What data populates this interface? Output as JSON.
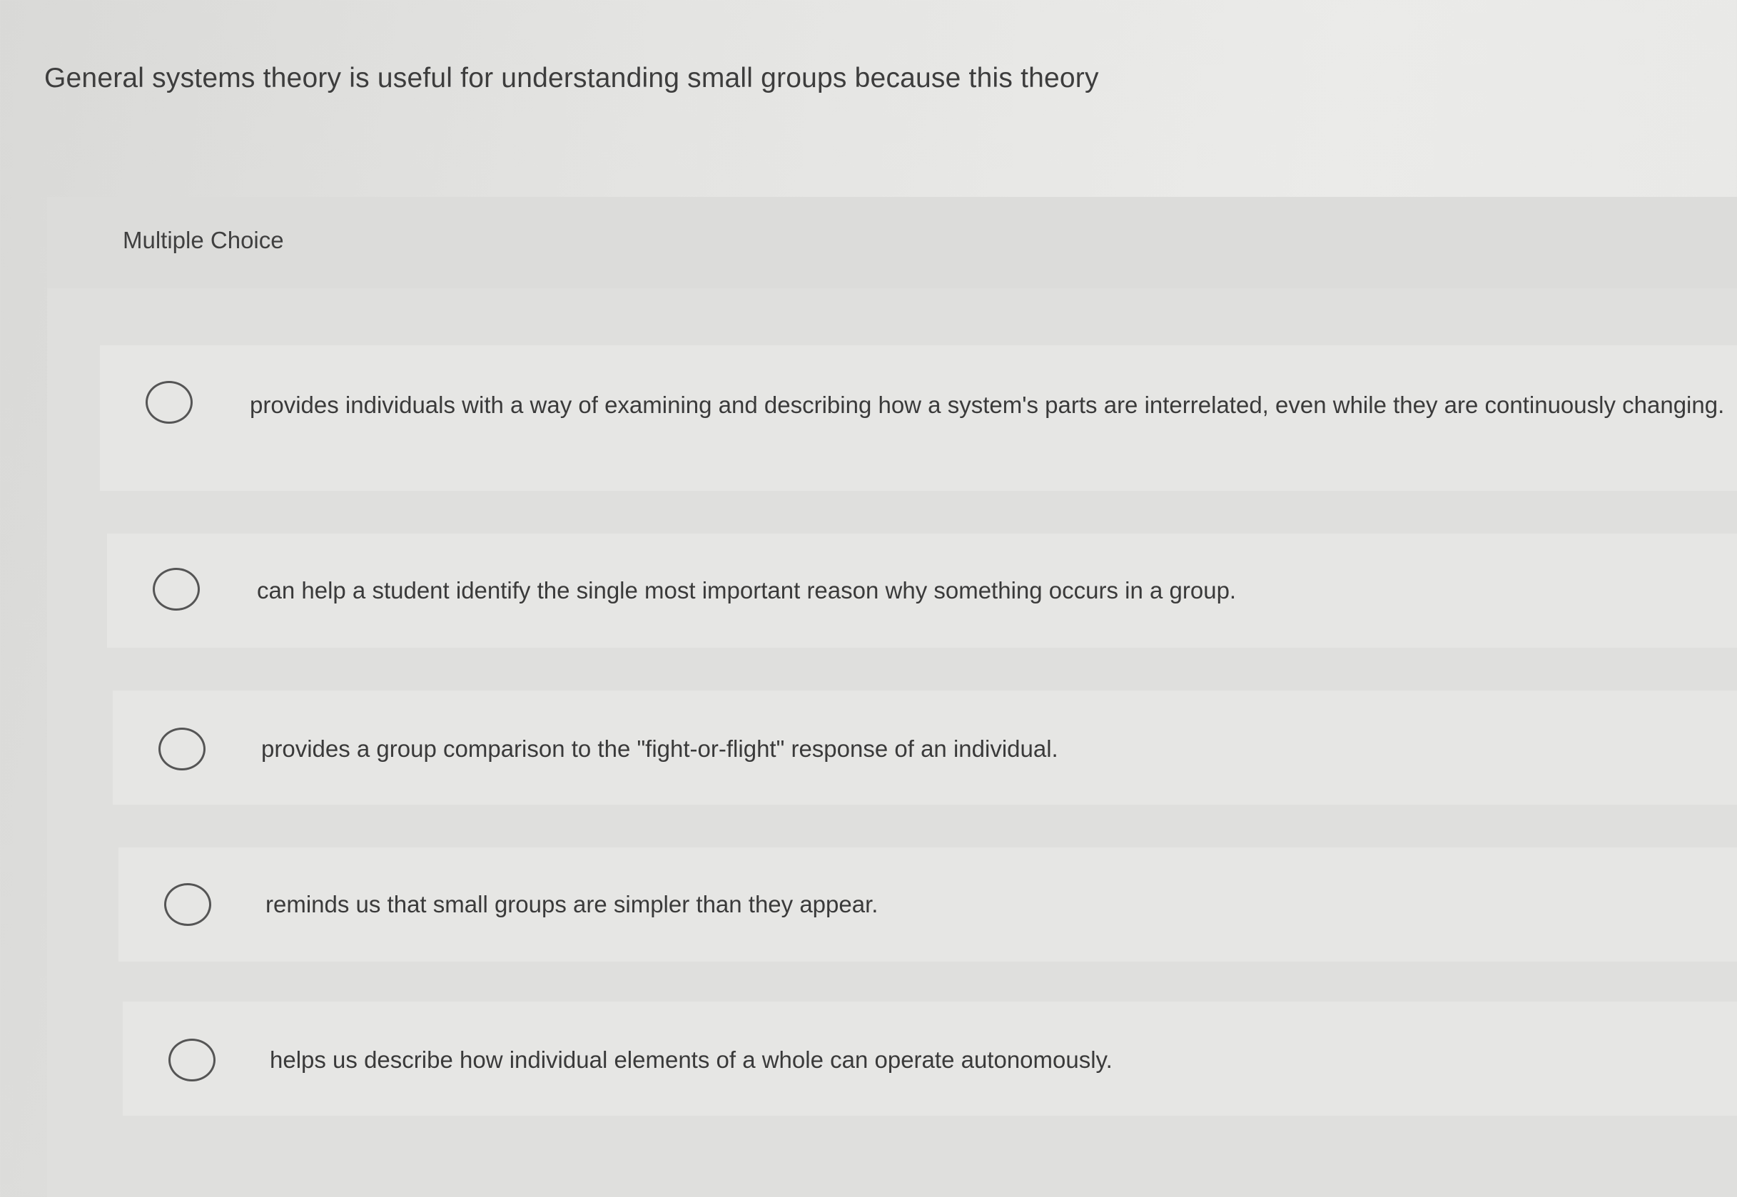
{
  "question": {
    "text": "General systems theory is useful for understanding small groups because this theory"
  },
  "panel": {
    "title": "Multiple Choice"
  },
  "options": [
    {
      "label": "provides individuals with a way of examining and describing how a system's parts are interrelated, even while they are continuously changing."
    },
    {
      "label": "can help a student identify the single most important reason why something occurs in a group."
    },
    {
      "label": "provides a group comparison to the \"fight-or-flight\" response of an individual."
    },
    {
      "label": "reminds us that small groups are simpler than they appear."
    },
    {
      "label": "helps us describe how individual elements of a whole can operate autonomously."
    }
  ]
}
